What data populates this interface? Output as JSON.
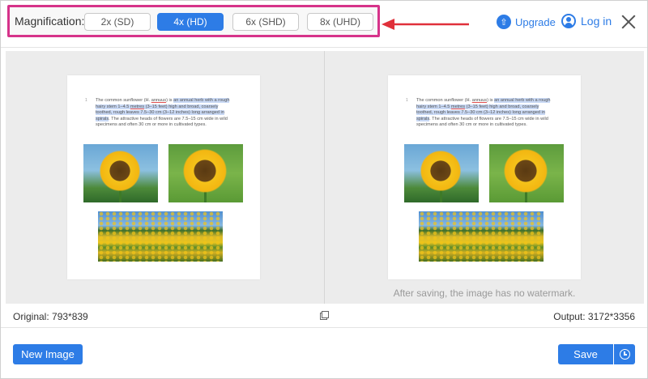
{
  "magnification": {
    "label": "Magnification:",
    "options": [
      {
        "label": "2x (SD)",
        "active": false
      },
      {
        "label": "4x (HD)",
        "active": true
      },
      {
        "label": "6x (SHD)",
        "active": false
      },
      {
        "label": "8x (UHD)",
        "active": false
      }
    ],
    "highlight_color": "#d6338a",
    "arrow_color": "#e0303a"
  },
  "header": {
    "upgrade_label": "Upgrade",
    "login_label": "Log in"
  },
  "document": {
    "line_number": "1",
    "paragraph_start": "The common sunflower (H. ",
    "species": "annuus",
    "paragraph_mid": ") is ",
    "highlight_1": "an annual herb with a rough hairy stem 1–4.5 ",
    "metres": "metres",
    "highlight_2": " (3–15 feet) high and broad, coarsely toothed, rough leaves 7.5–30 cm (3–12 inches) long arranged in spirals",
    "paragraph_end": ". The attractive heads of flowers are 7.5–15 cm wide in wild specimens and often 30 cm or more in cultivated types."
  },
  "preview": {
    "no_watermark_note": "After saving, the image has no watermark."
  },
  "info": {
    "original": "Original: 793*839",
    "output": "Output: 3172*3356"
  },
  "footer": {
    "new_image_label": "New Image",
    "save_label": "Save"
  },
  "colors": {
    "accent": "#2d7ce6",
    "panel_bg": "#ececec"
  }
}
